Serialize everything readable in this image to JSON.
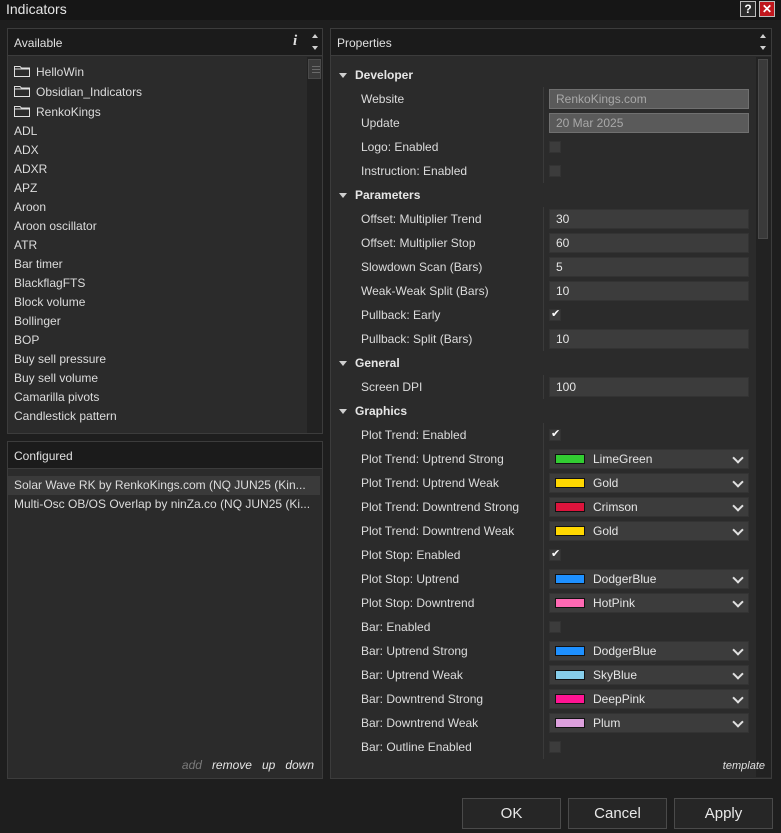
{
  "window": {
    "title": "Indicators",
    "help_glyph": "?",
    "close_glyph": "✕"
  },
  "available": {
    "header": "Available",
    "info_glyph": "i",
    "folders": [
      "HelloWin",
      "Obsidian_Indicators",
      "RenkoKings"
    ],
    "items": [
      "ADL",
      "ADX",
      "ADXR",
      "APZ",
      "Aroon",
      "Aroon oscillator",
      "ATR",
      "Bar timer",
      "BlackflagFTS",
      "Block volume",
      "Bollinger",
      "BOP",
      "Buy sell pressure",
      "Buy sell volume",
      "Camarilla pivots",
      "Candlestick pattern"
    ]
  },
  "configured": {
    "header": "Configured",
    "items": [
      "Solar Wave RK by RenkoKings.com (NQ JUN25 (Kin...",
      "Multi-Osc OB/OS Overlap by ninZa.co (NQ JUN25 (Ki..."
    ],
    "actions": {
      "add": "add",
      "remove": "remove",
      "up": "up",
      "down": "down"
    }
  },
  "properties": {
    "header": "Properties",
    "rows": [
      {
        "type": "category",
        "label": "Developer"
      },
      {
        "type": "readonly",
        "label": "Website",
        "value": "RenkoKings.com"
      },
      {
        "type": "readonly",
        "label": "Update",
        "value": "20 Mar 2025"
      },
      {
        "type": "checkbox",
        "label": "Logo: Enabled",
        "checked": false
      },
      {
        "type": "checkbox",
        "label": "Instruction: Enabled",
        "checked": false
      },
      {
        "type": "category",
        "label": "Parameters"
      },
      {
        "type": "text",
        "label": "Offset: Multiplier Trend",
        "value": "30"
      },
      {
        "type": "text",
        "label": "Offset: Multiplier Stop",
        "value": "60"
      },
      {
        "type": "text",
        "label": "Slowdown Scan (Bars)",
        "value": "5"
      },
      {
        "type": "text",
        "label": "Weak-Weak Split (Bars)",
        "value": "10"
      },
      {
        "type": "checkbox",
        "label": "Pullback: Early",
        "checked": true
      },
      {
        "type": "text",
        "label": "Pullback: Split (Bars)",
        "value": "10"
      },
      {
        "type": "category",
        "label": "General"
      },
      {
        "type": "text",
        "label": "Screen DPI",
        "value": "100"
      },
      {
        "type": "category",
        "label": "Graphics"
      },
      {
        "type": "checkbox",
        "label": "Plot Trend: Enabled",
        "checked": true
      },
      {
        "type": "color",
        "label": "Plot Trend: Uptrend Strong",
        "value": "LimeGreen",
        "hex": "#32cd32"
      },
      {
        "type": "color",
        "label": "Plot Trend: Uptrend Weak",
        "value": "Gold",
        "hex": "#ffd700"
      },
      {
        "type": "color",
        "label": "Plot Trend: Downtrend Strong",
        "value": "Crimson",
        "hex": "#dc143c"
      },
      {
        "type": "color",
        "label": "Plot Trend: Downtrend Weak",
        "value": "Gold",
        "hex": "#ffd700"
      },
      {
        "type": "checkbox",
        "label": "Plot Stop: Enabled",
        "checked": true
      },
      {
        "type": "color",
        "label": "Plot Stop: Uptrend",
        "value": "DodgerBlue",
        "hex": "#1e90ff"
      },
      {
        "type": "color",
        "label": "Plot Stop: Downtrend",
        "value": "HotPink",
        "hex": "#ff69b4"
      },
      {
        "type": "checkbox",
        "label": "Bar: Enabled",
        "checked": false
      },
      {
        "type": "color",
        "label": "Bar: Uptrend Strong",
        "value": "DodgerBlue",
        "hex": "#1e90ff"
      },
      {
        "type": "color",
        "label": "Bar: Uptrend Weak",
        "value": "SkyBlue",
        "hex": "#87ceeb"
      },
      {
        "type": "color",
        "label": "Bar: Downtrend Strong",
        "value": "DeepPink",
        "hex": "#ff1493"
      },
      {
        "type": "color",
        "label": "Bar: Downtrend Weak",
        "value": "Plum",
        "hex": "#dda0dd"
      },
      {
        "type": "checkbox",
        "label": "Bar: Outline Enabled",
        "checked": false
      }
    ],
    "template_link": "template"
  },
  "buttons": {
    "ok": "OK",
    "cancel": "Cancel",
    "apply": "Apply"
  },
  "colors": {
    "background": "#1e1e1e",
    "panel": "#2b2b2b",
    "header": "#1b1b1b",
    "close": "#c0161c"
  }
}
